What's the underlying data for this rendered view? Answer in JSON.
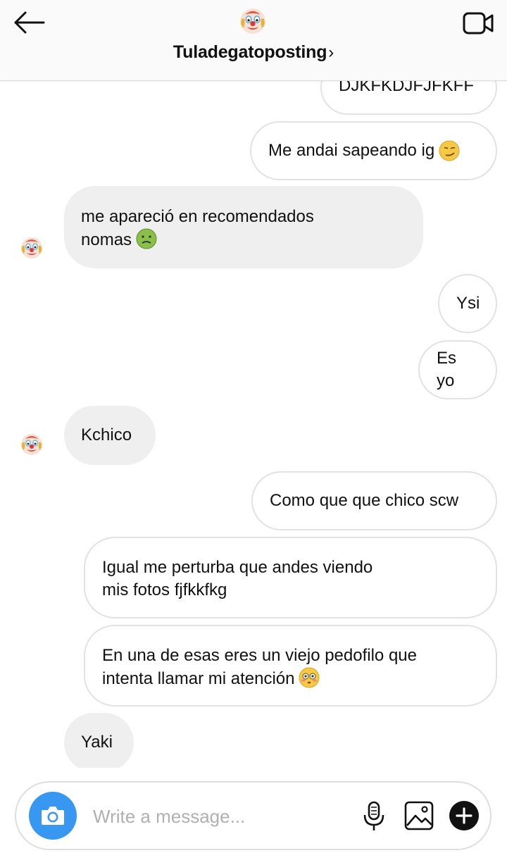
{
  "header": {
    "title": "Tuladegatoposting",
    "chevron": "›",
    "back_icon": "arrow-left-icon",
    "video_icon": "video-call-icon"
  },
  "messages": [
    {
      "from": "me",
      "text": "DJKFKDJFJFKFF"
    },
    {
      "from": "me",
      "text": "Me andai sapeando ig",
      "emoji": "smirk-emoji"
    },
    {
      "from": "them",
      "text": "me apareció en recomendados",
      "text2": "nomas",
      "emoji": "nauseated-emoji"
    },
    {
      "from": "me",
      "text": "Ysi"
    },
    {
      "from": "me",
      "text": "Es yo"
    },
    {
      "from": "them",
      "text": "Kchico"
    },
    {
      "from": "me",
      "text": "Como que que chico scw"
    },
    {
      "from": "me",
      "text": "Igual me perturba que andes viendo",
      "text2": "mis fotos fjfkkfkg"
    },
    {
      "from": "me",
      "text": "En una de esas eres un viejo pedofilo que",
      "text2": "intenta llamar mi atención",
      "emoji": "flushed-emoji"
    },
    {
      "from": "them",
      "text": "Yaki"
    }
  ],
  "composer": {
    "placeholder": "Write a message...",
    "icons": [
      "camera-icon",
      "microphone-icon",
      "gallery-icon",
      "plus-icon"
    ]
  },
  "colors": {
    "accent": "#3897f0",
    "incoming_bubble": "#efefef",
    "outgoing_border": "#e2e2e2"
  }
}
